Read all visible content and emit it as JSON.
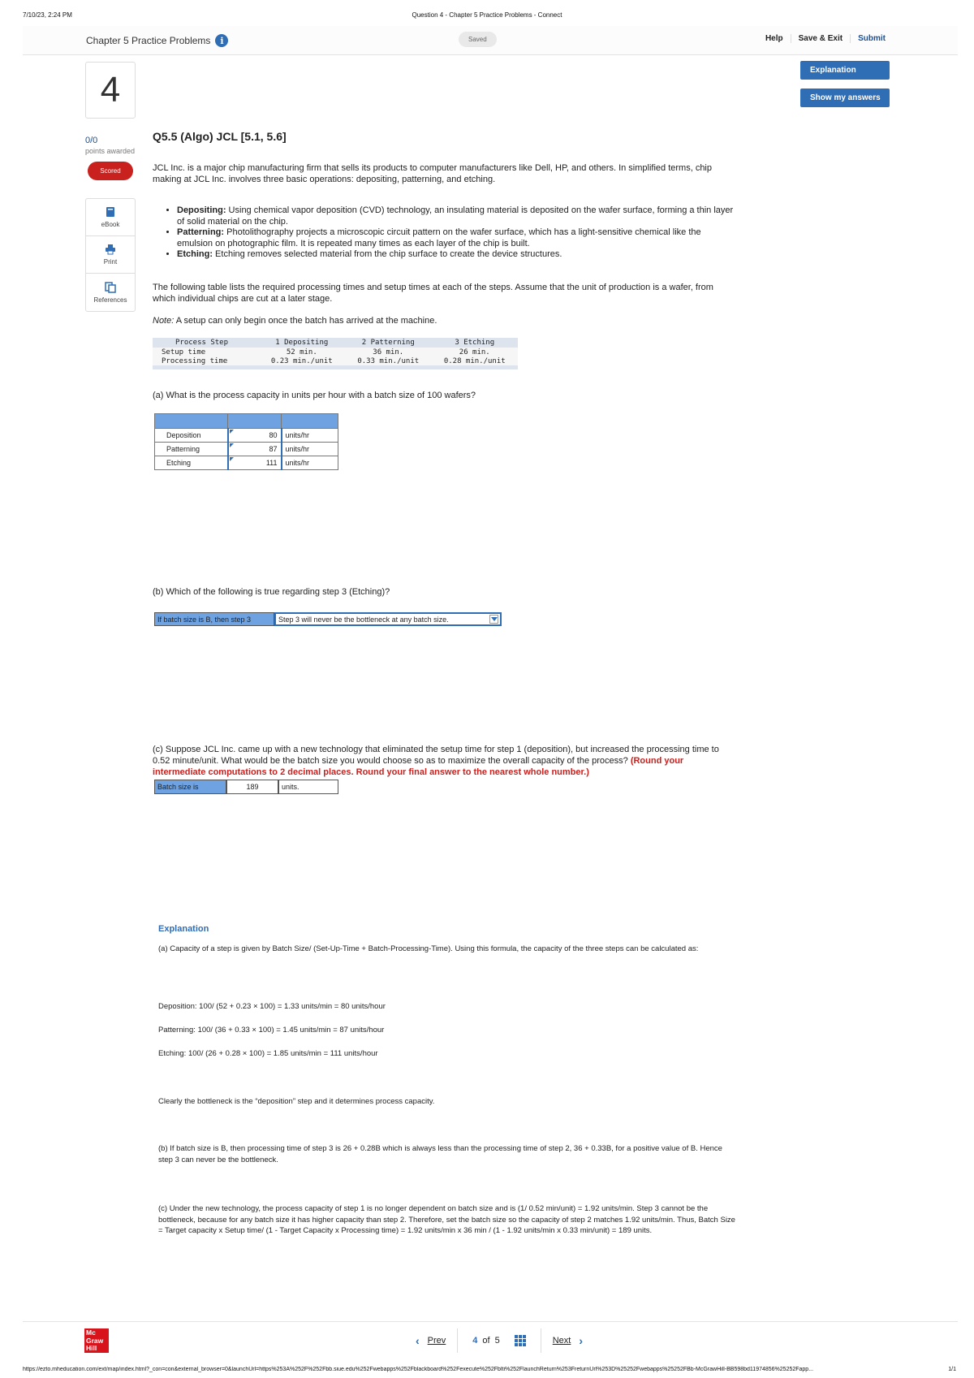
{
  "print": {
    "datetime": "7/10/23, 2:24 PM",
    "page_title": "Question 4 - Chapter 5 Practice Problems - Connect",
    "url": "https://ezto.mheducation.com/ext/map/index.html?_con=con&external_browser=0&launchUrl=https%253A%252F%252Fbb.siue.edu%252Fwebapps%252Fblackboard%252Fexecute%252Fblti%252FlaunchReturn%253FreturnUrl%253D%25252Fwebapps%25252FBb-McGrawHill-BB598bd11974856%25252Fapp...",
    "page_number": "1/1"
  },
  "topbar": {
    "title": "Chapter 5 Practice Problems",
    "info_glyph": "i",
    "saved": "Saved",
    "help": "Help",
    "save_exit": "Save & Exit",
    "submit": "Submit"
  },
  "side_buttons": {
    "explanation": "Explanation",
    "show_answers": "Show my answers"
  },
  "question": {
    "number": "4",
    "points": "0/0",
    "points_label": "points awarded",
    "status": "Scored",
    "title": "Q5.5 (Algo) JCL [5.1, 5.6]"
  },
  "tools": [
    {
      "label": "eBook",
      "icon": "book-icon"
    },
    {
      "label": "Print",
      "icon": "printer-icon"
    },
    {
      "label": "References",
      "icon": "references-icon"
    }
  ],
  "intro": "JCL Inc. is a major chip manufacturing firm that sells its products to computer manufacturers like Dell, HP, and others. In simplified terms, chip making at JCL Inc. involves three basic operations: depositing, patterning, and etching.",
  "bullets": [
    {
      "term": "Depositing:",
      "text": " Using chemical vapor deposition (CVD) technology, an insulating material is deposited on the wafer surface, forming a thin layer of solid material on the chip."
    },
    {
      "term": "Patterning:",
      "text": " Photolithography projects a microscopic circuit pattern on the wafer surface, which has a light-sensitive chemical like the emulsion on photographic film. It is repeated many times as each layer of the chip is built."
    },
    {
      "term": "Etching:",
      "text": " Etching removes selected material from the chip surface to create the device structures."
    }
  ],
  "table_intro": "The following table lists the required processing times and setup times at each of the steps. Assume that the unit of production is a wafer, from which individual chips are cut at a later stage.",
  "note_label": "Note:",
  "note_text": " A setup can only begin once the batch has arrived at the machine.",
  "process_table": {
    "headers": [
      "Process Step",
      "1 Depositing",
      "2 Patterning",
      "3 Etching"
    ],
    "rows": [
      [
        "Setup time",
        "52 min.",
        "36 min.",
        "26 min."
      ],
      [
        "Processing time",
        "0.23 min./unit",
        "0.33 min./unit",
        "0.28 min./unit"
      ]
    ]
  },
  "part_a": {
    "question": "(a) What is the process capacity in units per hour with a batch size of 100 wafers?",
    "rows": [
      {
        "label": "Deposition",
        "value": "80",
        "unit": "units/hr"
      },
      {
        "label": "Patterning",
        "value": "87",
        "unit": "units/hr"
      },
      {
        "label": "Etching",
        "value": "111",
        "unit": "units/hr"
      }
    ]
  },
  "part_b": {
    "question": "(b) Which of the following is true regarding step 3 (Etching)?",
    "label": "If batch size is B, then step 3",
    "selected": "Step 3 will never be the bottleneck at any batch size."
  },
  "part_c": {
    "question": "(c)  Suppose JCL Inc. came up with a new technology that eliminated the setup time for step 1 (deposition), but increased the processing time to 0.52 minute/unit. What would be the batch size you would choose so as to maximize the overall capacity of the process? ",
    "instruction": "(Round your intermediate computations to 2 decimal places. Round your final answer to the nearest whole number.)",
    "label": "Batch size is",
    "value": "189",
    "unit": "units."
  },
  "explanation": {
    "title": "Explanation",
    "a_intro": "(a) Capacity of a step is given by Batch Size/ (Set-Up-Time + Batch-Processing-Time). Using this formula, the capacity of the three steps can be calculated as:",
    "deposition": "Deposition: 100/ (52 + 0.23 × 100) = 1.33 units/min = 80 units/hour",
    "patterning": "Patterning: 100/ (36 + 0.33 × 100) = 1.45 units/min = 87 units/hour",
    "etching": "Etching: 100/ (26 + 0.28 × 100) = 1.85 units/min = 111 units/hour",
    "bottleneck": "Clearly the bottleneck is the “deposition” step and it determines process capacity.",
    "b": "(b) If batch size is B, then processing time of step 3 is 26 + 0.28B which is always less than the processing time of step 2, 36 + 0.33B, for a positive value of B. Hence step 3 can never be the bottleneck.",
    "c": "(c) Under the new technology, the process capacity of step 1 is no longer dependent on batch size and is (1/ 0.52 min/unit) = 1.92 units/min. Step 3 cannot be the bottleneck, because for any batch size it has higher capacity than step 2. Therefore, set the batch size so the capacity of step 2 matches 1.92 units/min. Thus, Batch Size = Target capacity x Setup time/ (1 - Target Capacity x Processing time) = 1.92 units/min x 36 min / (1 - 1.92 units/min x 0.33 min/unit) = 189 units."
  },
  "footer": {
    "logo_lines": [
      "Mc",
      "Graw",
      "Hill"
    ],
    "prev": "Prev",
    "current": "4",
    "of": "of",
    "total": "5",
    "next": "Next"
  },
  "colors": {
    "accent": "#2f6db5",
    "scored": "#c9211e",
    "cell_header": "#6fa2e0",
    "logo": "#d7131b"
  }
}
